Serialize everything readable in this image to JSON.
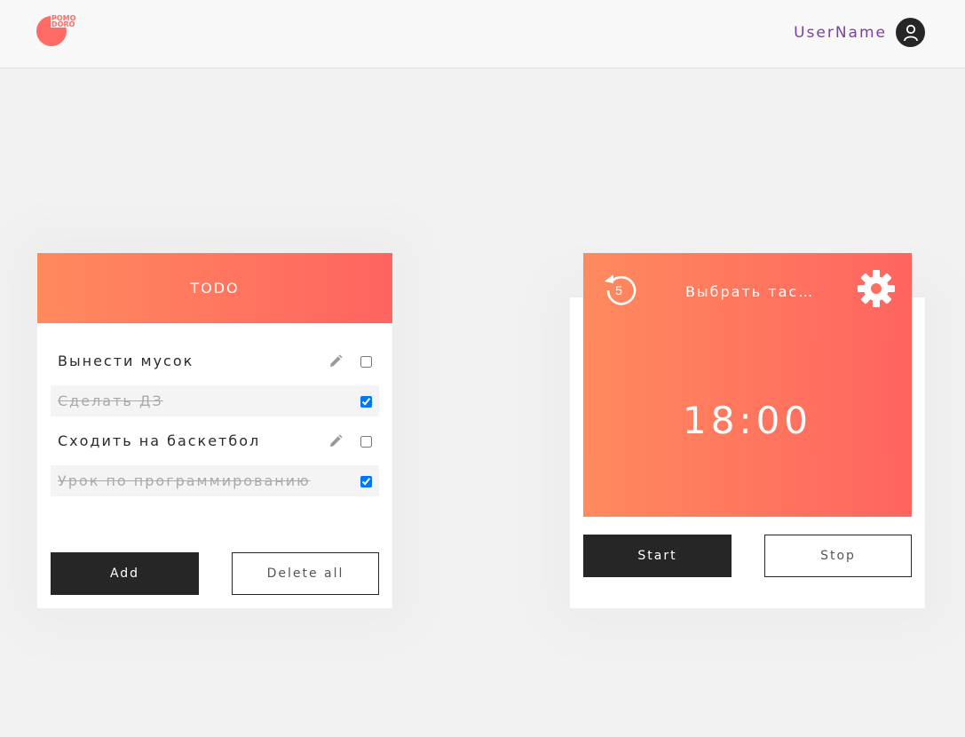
{
  "header": {
    "logo_text": [
      "POMO",
      "DORO"
    ],
    "username": "UserName",
    "avatar_icon": "user-icon"
  },
  "todo": {
    "title": "TODO",
    "items": [
      {
        "label": "Вынести мусок",
        "done": false
      },
      {
        "label": "Сделать ДЗ",
        "done": true
      },
      {
        "label": "Сходить на баскетбол",
        "done": false
      },
      {
        "label": "Урок по программированию",
        "done": true
      }
    ],
    "add_label": "Add",
    "delete_all_label": "Delete all"
  },
  "timer": {
    "replay_value": "5",
    "task_placeholder": "Выбрать тас…",
    "time": "18:00",
    "start_label": "Start",
    "stop_label": "Stop"
  },
  "colors": {
    "accent_start": "#ff8a5e",
    "accent_end": "#ff6460",
    "dark": "#262626",
    "username": "#7b3fa0"
  }
}
